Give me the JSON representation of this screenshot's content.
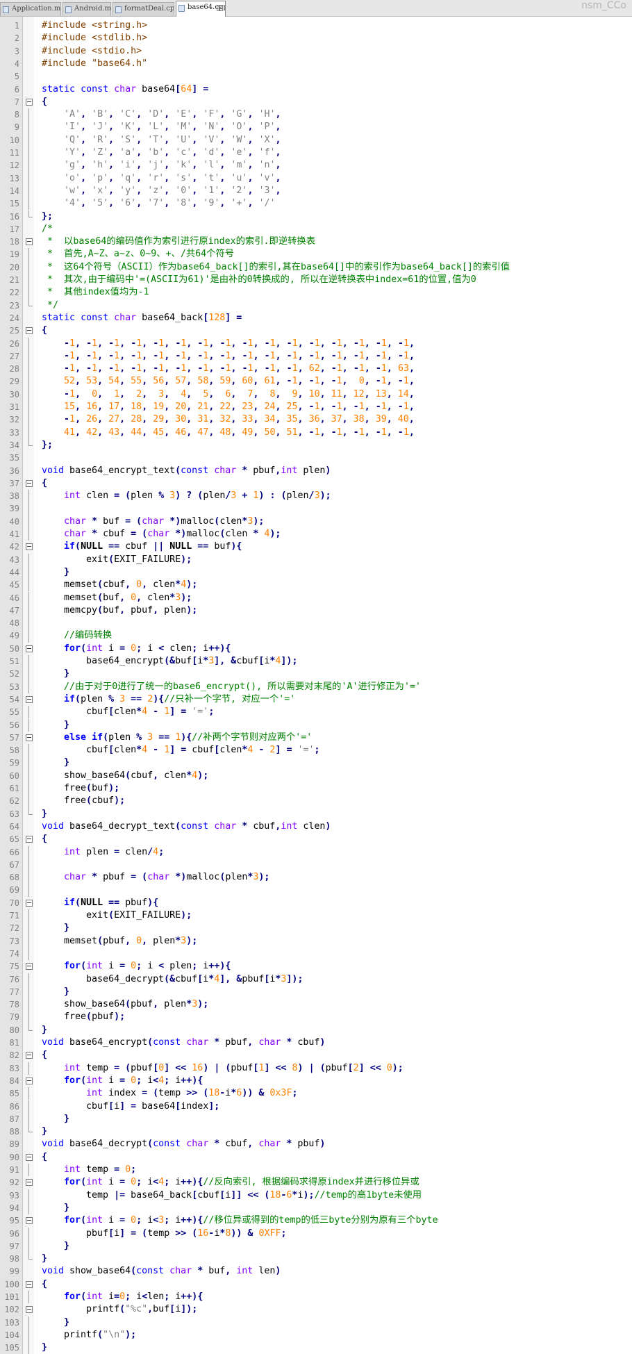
{
  "tabs": [
    {
      "label": "Application.mk",
      "active": false
    },
    {
      "label": "Android.mk",
      "active": false
    },
    {
      "label": "formatDeal.cpp",
      "active": false
    },
    {
      "label": "base64.cpp",
      "active": true
    }
  ],
  "watermark": "nsm_CCo",
  "code_lines": [
    "#include <string.h>",
    "#include <stdlib.h>",
    "#include <stdio.h>",
    "#include \"base64.h\"",
    "",
    "static const char base64[64] =",
    "{",
    "    'A', 'B', 'C', 'D', 'E', 'F', 'G', 'H',",
    "    'I', 'J', 'K', 'L', 'M', 'N', 'O', 'P',",
    "    'Q', 'R', 'S', 'T', 'U', 'V', 'W', 'X',",
    "    'Y', 'Z', 'a', 'b', 'c', 'd', 'e', 'f',",
    "    'g', 'h', 'i', 'j', 'k', 'l', 'm', 'n',",
    "    'o', 'p', 'q', 'r', 's', 't', 'u', 'v',",
    "    'w', 'x', 'y', 'z', '0', '1', '2', '3',",
    "    '4', '5', '6', '7', '8', '9', '+', '/'",
    "};",
    "/*",
    " *  以base64的编码值作为索引进行原index的索引.即逆转换表",
    " *  首先,A~Z、a~z、0~9、+、/共64个符号",
    " *  这64个符号（ASCII）作为base64_back[]的索引,其在base64[]中的索引作为base64_back[]的索引值",
    " *  其次,由于编码中'=(ASCII为61)'是由补的0转换成的, 所以在逆转换表中index=61的位置,值为0",
    " *  其他index值均为-1",
    " */",
    "static const char base64_back[128] =",
    "{",
    "    -1, -1, -1, -1, -1, -1, -1, -1, -1, -1, -1, -1, -1, -1, -1, -1,",
    "    -1, -1, -1, -1, -1, -1, -1, -1, -1, -1, -1, -1, -1, -1, -1, -1,",
    "    -1, -1, -1, -1, -1, -1, -1, -1, -1, -1, -1, 62, -1, -1, -1, 63,",
    "    52, 53, 54, 55, 56, 57, 58, 59, 60, 61, -1, -1, -1,  0, -1, -1,",
    "    -1,  0,  1,  2,  3,  4,  5,  6,  7,  8,  9, 10, 11, 12, 13, 14,",
    "    15, 16, 17, 18, 19, 20, 21, 22, 23, 24, 25, -1, -1, -1, -1, -1,",
    "    -1, 26, 27, 28, 29, 30, 31, 32, 33, 34, 35, 36, 37, 38, 39, 40,",
    "    41, 42, 43, 44, 45, 46, 47, 48, 49, 50, 51, -1, -1, -1, -1, -1,",
    "};",
    "",
    "void base64_encrypt_text(const char * pbuf,int plen)",
    "{",
    "    int clen = (plen % 3) ? (plen/3 + 1) : (plen/3);",
    "",
    "    char * buf = (char *)malloc(clen*3);",
    "    char * cbuf = (char *)malloc(clen * 4);",
    "    if(NULL == cbuf || NULL == buf){",
    "        exit(EXIT_FAILURE);",
    "    }",
    "    memset(cbuf, 0, clen*4);",
    "    memset(buf, 0, clen*3);",
    "    memcpy(buf, pbuf, plen);",
    "",
    "    //编码转换",
    "    for(int i = 0; i < clen; i++){",
    "        base64_encrypt(&buf[i*3], &cbuf[i*4]);",
    "    }",
    "    //由于对于0进行了统一的base6_encrypt(), 所以需要对末尾的'A'进行修正为'='",
    "    if(plen % 3 == 2){//只补一个字节, 对应一个'='",
    "        cbuf[clen*4 - 1] = '=';",
    "    }",
    "    else if(plen % 3 == 1){//补两个字节则对应两个'='",
    "        cbuf[clen*4 - 1] = cbuf[clen*4 - 2] = '=';",
    "    }",
    "    show_base64(cbuf, clen*4);",
    "    free(buf);",
    "    free(cbuf);",
    "}",
    "void base64_decrypt_text(const char * cbuf,int clen)",
    "{",
    "    int plen = clen/4;",
    "",
    "    char * pbuf = (char *)malloc(plen*3);",
    "",
    "    if(NULL == pbuf){",
    "        exit(EXIT_FAILURE);",
    "    }",
    "    memset(pbuf, 0, plen*3);",
    "",
    "    for(int i = 0; i < plen; i++){",
    "        base64_decrypt(&cbuf[i*4], &pbuf[i*3]);",
    "    }",
    "    show_base64(pbuf, plen*3);",
    "    free(pbuf);",
    "}",
    "void base64_encrypt(const char * pbuf, char * cbuf)",
    "{",
    "    int temp = (pbuf[0] << 16) | (pbuf[1] << 8) | (pbuf[2] << 0);",
    "    for(int i = 0; i<4; i++){",
    "        int index = (temp >> (18-i*6)) & 0x3F;",
    "        cbuf[i] = base64[index];",
    "    }",
    "}",
    "void base64_decrypt(const char * cbuf, char * pbuf)",
    "{",
    "    int temp = 0;",
    "    for(int i = 0; i<4; i++){//反向索引, 根据编码求得原index并进行移位异或",
    "        temp |= base64_back[cbuf[i]] << (18-6*i);//temp的高1byte未使用",
    "    }",
    "    for(int i = 0; i<3; i++){//移位异或得到的temp的低三byte分别为原有三个byte",
    "        pbuf[i] = (temp >> (16-i*8)) & 0XFF;",
    "    }",
    "}",
    "void show_base64(const char * buf, int len)",
    "{",
    "    for(int i=0; i<len; i++){",
    "        printf(\"%c\",buf[i]);",
    "    }",
    "    printf(\"\\n\");",
    "}"
  ],
  "colors": {
    "keyword": "#0000ff",
    "type": "#8000ff",
    "number": "#ff8000",
    "string": "#808080",
    "preprocessor": "#804000",
    "comment": "#008000",
    "operator": "#000080"
  }
}
